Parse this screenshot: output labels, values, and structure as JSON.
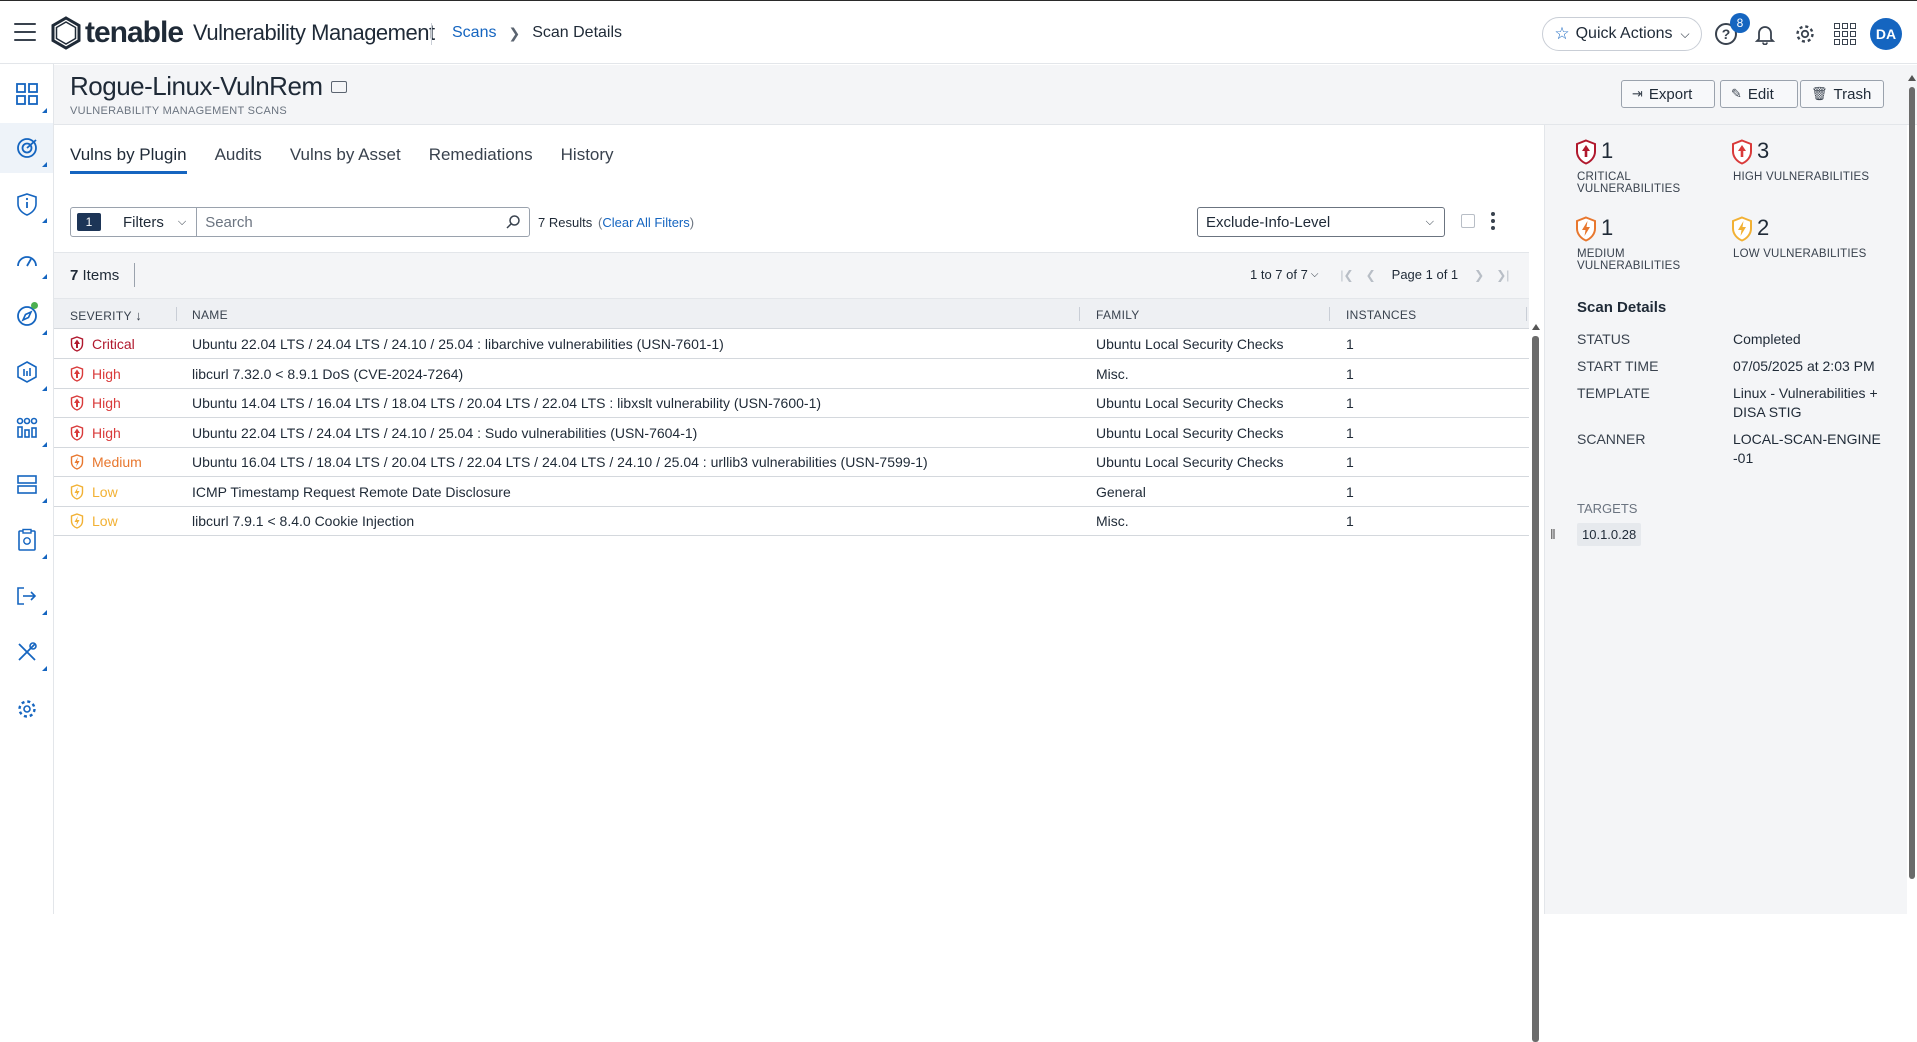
{
  "app": {
    "brand": "tenable",
    "product": "Vulnerability Management"
  },
  "breadcrumb": {
    "parent": "Scans",
    "current": "Scan Details"
  },
  "topbar": {
    "quick_actions": "Quick Actions",
    "help_badge": "8",
    "avatar_initials": "DA"
  },
  "page": {
    "title": "Rogue-Linux-VulnRem",
    "subtitle": "VULNERABILITY MANAGEMENT SCANS",
    "export_label": "Export",
    "edit_label": "Edit",
    "trash_label": "Trash"
  },
  "tabs": [
    {
      "label": "Vulns by Plugin",
      "active": true
    },
    {
      "label": "Audits",
      "active": false
    },
    {
      "label": "Vulns by Asset",
      "active": false
    },
    {
      "label": "Remediations",
      "active": false
    },
    {
      "label": "History",
      "active": false
    }
  ],
  "filters": {
    "count": "1",
    "label": "Filters",
    "search_placeholder": "Search",
    "results": "7 Results",
    "clear_all": "Clear All Filters",
    "view_select": "Exclude-Info-Level"
  },
  "table": {
    "items_count": "7",
    "items_label": "Items",
    "pager_range": "1 to 7 of 7",
    "page_label": "Page 1 of 1",
    "headers": {
      "severity": "SEVERITY",
      "name": "NAME",
      "family": "FAMILY",
      "instances": "INSTANCES"
    },
    "rows": [
      {
        "severity": "Critical",
        "name": "Ubuntu 22.04 LTS / 24.04 LTS / 24.10 / 25.04 : libarchive vulnerabilities (USN-7601-1)",
        "family": "Ubuntu Local Security Checks",
        "instances": "1"
      },
      {
        "severity": "High",
        "name": "libcurl 7.32.0 < 8.9.1 DoS (CVE-2024-7264)",
        "family": "Misc.",
        "instances": "1"
      },
      {
        "severity": "High",
        "name": "Ubuntu 14.04 LTS / 16.04 LTS / 18.04 LTS / 20.04 LTS / 22.04 LTS : libxslt vulnerability (USN-7600-1)",
        "family": "Ubuntu Local Security Checks",
        "instances": "1"
      },
      {
        "severity": "High",
        "name": "Ubuntu 22.04 LTS / 24.04 LTS / 24.10 / 25.04 : Sudo vulnerabilities (USN-7604-1)",
        "family": "Ubuntu Local Security Checks",
        "instances": "1"
      },
      {
        "severity": "Medium",
        "name": "Ubuntu 16.04 LTS / 18.04 LTS / 20.04 LTS / 22.04 LTS / 24.04 LTS / 24.10 / 25.04 : urllib3 vulnerabilities (USN-7599-1)",
        "family": "Ubuntu Local Security Checks",
        "instances": "1"
      },
      {
        "severity": "Low",
        "name": "ICMP Timestamp Request Remote Date Disclosure",
        "family": "General",
        "instances": "1"
      },
      {
        "severity": "Low",
        "name": "libcurl 7.9.1 < 8.4.0 Cookie Injection",
        "family": "Misc.",
        "instances": "1"
      }
    ]
  },
  "summary": {
    "critical": {
      "count": "1",
      "label": "CRITICAL VULNERABILITIES"
    },
    "high": {
      "count": "3",
      "label": "HIGH VULNERABILITIES"
    },
    "medium": {
      "count": "1",
      "label": "MEDIUM VULNERABILITIES"
    },
    "low": {
      "count": "2",
      "label": "LOW VULNERABILITIES"
    }
  },
  "scan_details": {
    "title": "Scan Details",
    "status_key": "STATUS",
    "status": "Completed",
    "start_key": "START TIME",
    "start_time": "07/05/2025 at 2:03 PM",
    "template_key": "TEMPLATE",
    "template": "Linux - Vulnerabilities + DISA STIG",
    "scanner_key": "SCANNER",
    "scanner": "LOCAL-SCAN-ENGINE-01",
    "targets_key": "TARGETS",
    "target": "10.1.0.28"
  },
  "colors": {
    "accent": "#1565c0",
    "critical": "#b0182d",
    "high": "#d93a3a",
    "medium": "#e8772e",
    "low": "#f2b134"
  },
  "icons": {
    "nav": [
      "dashboard-icon",
      "scans-icon",
      "info-icon",
      "gauge-icon",
      "explore-icon",
      "assets-icon",
      "reports-icon",
      "list-icon",
      "compliance-icon",
      "logout-icon",
      "tools-icon",
      "settings-icon"
    ]
  }
}
